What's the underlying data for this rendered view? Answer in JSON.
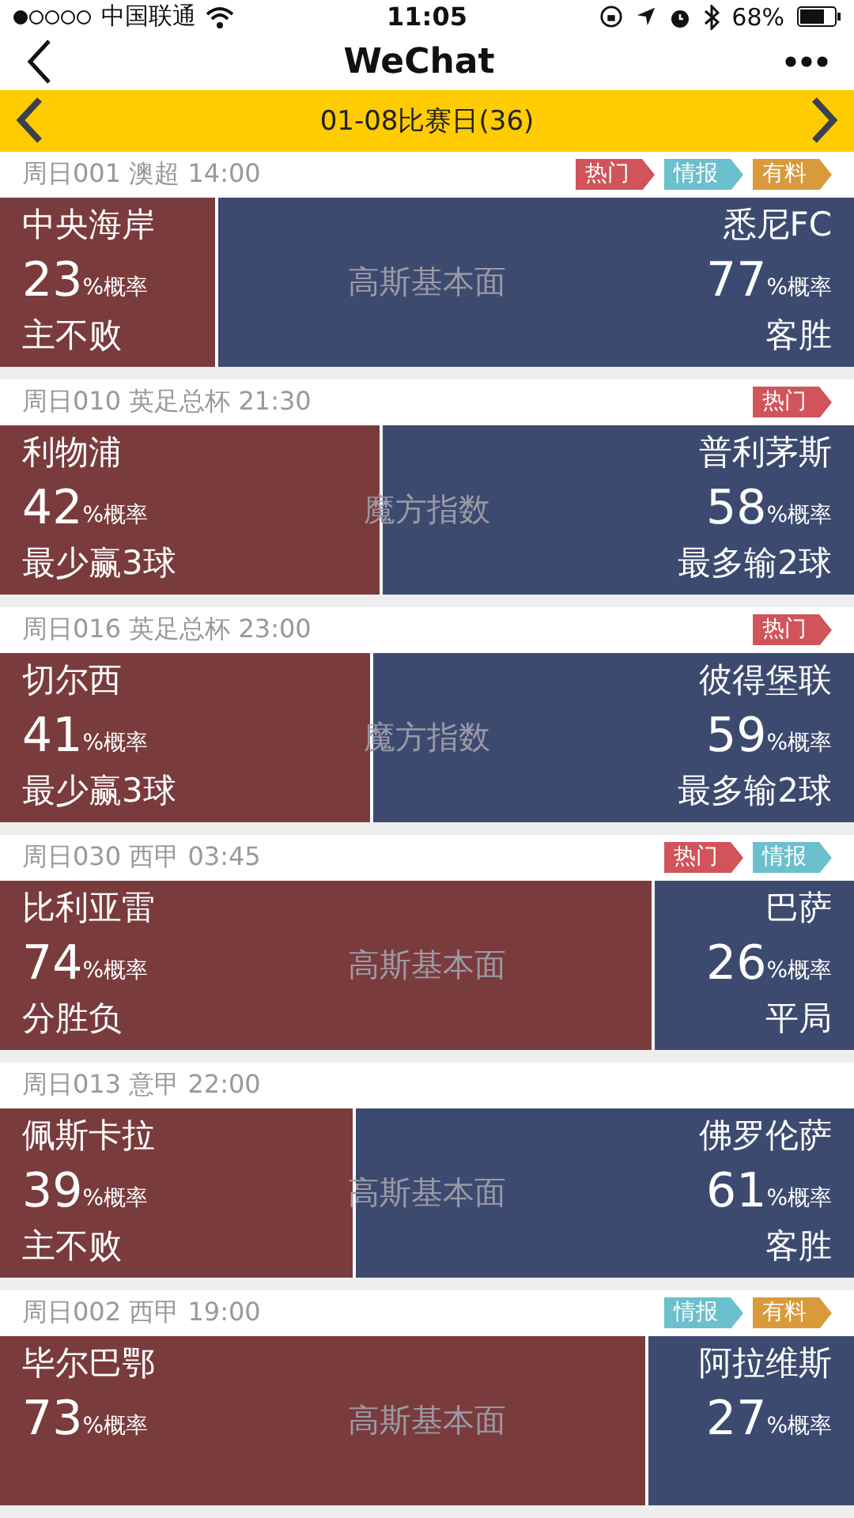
{
  "status_bar": {
    "carrier": "中国联通",
    "time": "11:05",
    "battery": "68%"
  },
  "nav": {
    "title": "WeChat"
  },
  "date_bar": {
    "label": "01-08比赛日(36)"
  },
  "matches": [
    {
      "header": "周日001 澳超 14:00",
      "tags": [
        {
          "label": "热门",
          "color": "#d0545a"
        },
        {
          "label": "情报",
          "color": "#6cbfcc"
        },
        {
          "label": "有料",
          "color": "#d99a3c"
        }
      ],
      "center": "高斯基本面",
      "home": {
        "team": "中央海岸",
        "percent": "23",
        "unit": "%概率",
        "result": "主不败"
      },
      "away": {
        "team": "悉尼FC",
        "percent": "77",
        "unit": "%概率",
        "result": "客胜"
      }
    },
    {
      "header": "周日010 英足总杯 21:30",
      "tags": [
        {
          "label": "热门",
          "color": "#d0545a"
        }
      ],
      "center": "魔方指数",
      "home": {
        "team": "利物浦",
        "percent": "42",
        "unit": "%概率",
        "result": "最少赢3球"
      },
      "away": {
        "team": "普利茅斯",
        "percent": "58",
        "unit": "%概率",
        "result": "最多输2球"
      }
    },
    {
      "header": "周日016 英足总杯 23:00",
      "tags": [
        {
          "label": "热门",
          "color": "#d0545a"
        }
      ],
      "center": "魔方指数",
      "home": {
        "team": "切尔西",
        "percent": "41",
        "unit": "%概率",
        "result": "最少赢3球"
      },
      "away": {
        "team": "彼得堡联",
        "percent": "59",
        "unit": "%概率",
        "result": "最多输2球"
      }
    },
    {
      "header": "周日030 西甲 03:45",
      "tags": [
        {
          "label": "热门",
          "color": "#d0545a"
        },
        {
          "label": "情报",
          "color": "#6cbfcc"
        }
      ],
      "center": "高斯基本面",
      "home": {
        "team": "比利亚雷",
        "percent": "74",
        "unit": "%概率",
        "result": "分胜负"
      },
      "away": {
        "team": "巴萨",
        "percent": "26",
        "unit": "%概率",
        "result": "平局"
      }
    },
    {
      "header": "周日013 意甲 22:00",
      "center": "高斯基本面",
      "home": {
        "team": "佩斯卡拉",
        "percent": "39",
        "unit": "%概率",
        "result": "主不败"
      },
      "away": {
        "team": "佛罗伦萨",
        "percent": "61",
        "unit": "%概率",
        "result": "客胜"
      }
    },
    {
      "header": "周日002 西甲 19:00",
      "tags": [
        {
          "label": "情报",
          "color": "#6cbfcc"
        },
        {
          "label": "有料",
          "color": "#d99a3c"
        }
      ],
      "center": "高斯基本面",
      "home": {
        "team": "毕尔巴鄂",
        "percent": "73",
        "unit": "%概率"
      },
      "away": {
        "team": "阿拉维斯",
        "percent": "27",
        "unit": "%概率"
      }
    }
  ]
}
